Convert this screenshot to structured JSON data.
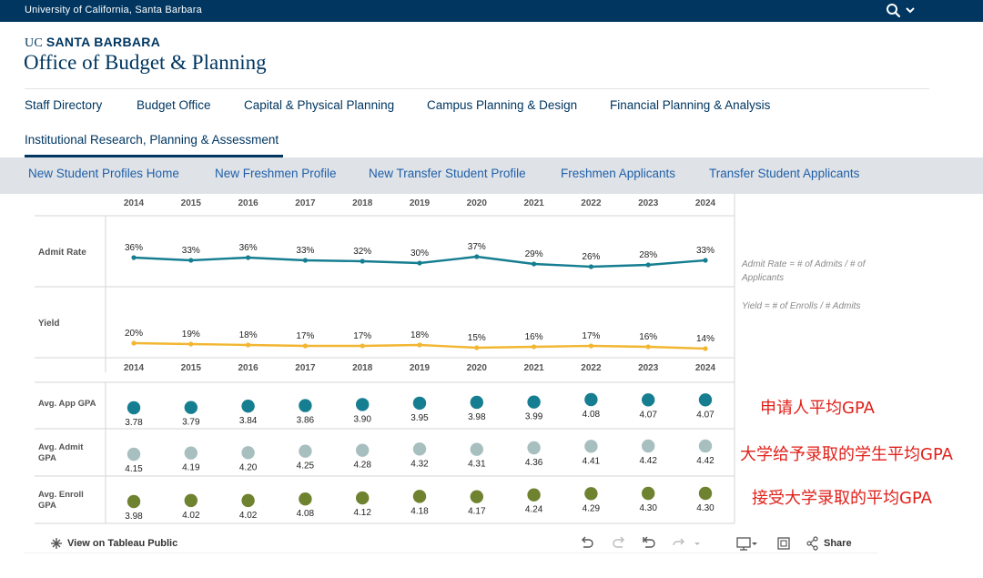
{
  "topbar": {
    "site_name": "University of California, Santa Barbara",
    "search_icon": "search-icon",
    "menu_icon": "chevron-down-icon"
  },
  "header": {
    "brand_prefix": "UC",
    "brand_name": "SANTA BARBARA",
    "office": "Office of Budget & Planning"
  },
  "primary_nav": [
    "Staff Directory",
    "Budget Office",
    "Capital & Physical Planning",
    "Campus Planning & Design",
    "Financial Planning & Analysis",
    "Institutional Research, Planning & Assessment"
  ],
  "secondary_nav": [
    "New Student Profiles Home",
    "New Freshmen Profile",
    "New Transfer Student Profile",
    "Freshmen Applicants",
    "Transfer Student Applicants"
  ],
  "colors": {
    "navy": "#003660",
    "teal": "#167e91",
    "gold": "#f2b632",
    "lightteal": "#a8bfc0",
    "olive": "#6f8230",
    "annotation": "#e0201a"
  },
  "notes": {
    "admit_rate": "Admit Rate = # of Admits / # of Applicants",
    "yield": "Yield = # of Enrolls / # Admits"
  },
  "annotations": [
    "申请人平均GPA",
    "大学给予录取的学生平均GPA",
    "接受大学录取的平均GPA"
  ],
  "chart_data": {
    "type": "line",
    "years": [
      "2014",
      "2015",
      "2016",
      "2017",
      "2018",
      "2019",
      "2020",
      "2021",
      "2022",
      "2023",
      "2024"
    ],
    "rows": [
      {
        "label": "Admit Rate",
        "kind": "line",
        "color": "#167e91",
        "values": [
          36,
          33,
          36,
          33,
          32,
          30,
          37,
          29,
          26,
          28,
          33
        ],
        "display": [
          "36%",
          "33%",
          "36%",
          "33%",
          "32%",
          "30%",
          "37%",
          "29%",
          "26%",
          "28%",
          "33%"
        ]
      },
      {
        "label": "Yield",
        "kind": "line",
        "color": "#f2b632",
        "values": [
          20,
          19,
          18,
          17,
          17,
          18,
          15,
          16,
          17,
          16,
          14
        ],
        "display": [
          "20%",
          "19%",
          "18%",
          "17%",
          "17%",
          "18%",
          "15%",
          "16%",
          "17%",
          "16%",
          "14%"
        ]
      },
      {
        "label": "Avg. App GPA",
        "kind": "dots",
        "color": "#167e91",
        "values": [
          3.78,
          3.79,
          3.84,
          3.86,
          3.9,
          3.95,
          3.98,
          3.99,
          4.08,
          4.07,
          4.07
        ],
        "display": [
          "3.78",
          "3.79",
          "3.84",
          "3.86",
          "3.90",
          "3.95",
          "3.98",
          "3.99",
          "4.08",
          "4.07",
          "4.07"
        ]
      },
      {
        "label": "Avg. Admit GPA",
        "kind": "dots",
        "color": "#a8bfc0",
        "values": [
          4.15,
          4.19,
          4.2,
          4.25,
          4.28,
          4.32,
          4.31,
          4.36,
          4.41,
          4.42,
          4.42
        ],
        "display": [
          "4.15",
          "4.19",
          "4.20",
          "4.25",
          "4.28",
          "4.32",
          "4.31",
          "4.36",
          "4.41",
          "4.42",
          "4.42"
        ]
      },
      {
        "label": "Avg. Enroll GPA",
        "kind": "dots",
        "color": "#6f8230",
        "values": [
          3.98,
          4.02,
          4.02,
          4.08,
          4.12,
          4.18,
          4.17,
          4.24,
          4.29,
          4.3,
          4.3
        ],
        "display": [
          "3.98",
          "4.02",
          "4.02",
          "4.08",
          "4.12",
          "4.18",
          "4.17",
          "4.24",
          "4.29",
          "4.30",
          "4.30"
        ]
      }
    ]
  },
  "toolbar": {
    "view_label": "View on Tableau Public",
    "share_label": "Share",
    "icons": [
      "tableau-icon",
      "undo-icon",
      "redo-icon",
      "revert-icon",
      "forward-icon",
      "caret-icon",
      "download-icon",
      "fullscreen-icon",
      "share-icon"
    ]
  }
}
